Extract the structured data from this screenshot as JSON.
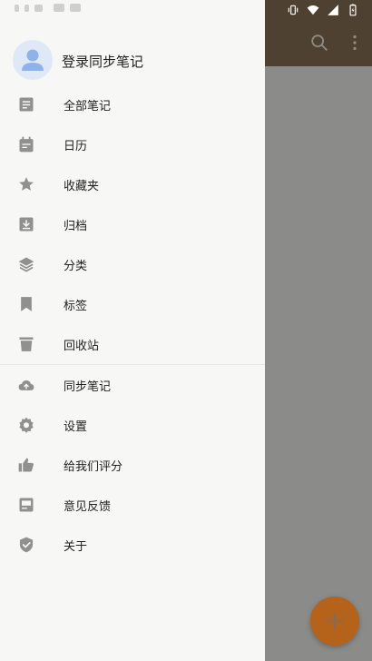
{
  "drawer": {
    "login_title": "登录同步笔记",
    "items": [
      {
        "label": "全部笔记",
        "icon": "notes-icon"
      },
      {
        "label": "日历",
        "icon": "calendar-icon"
      },
      {
        "label": "收藏夹",
        "icon": "star-icon"
      },
      {
        "label": "归档",
        "icon": "archive-icon"
      },
      {
        "label": "分类",
        "icon": "layers-icon"
      },
      {
        "label": "标签",
        "icon": "bookmark-icon"
      },
      {
        "label": "回收站",
        "icon": "trash-icon"
      }
    ],
    "secondary_items": [
      {
        "label": "同步笔记",
        "icon": "cloud-upload-icon"
      },
      {
        "label": "设置",
        "icon": "settings-icon"
      },
      {
        "label": "给我们评分",
        "icon": "thumb-up-icon"
      },
      {
        "label": "意见反馈",
        "icon": "feedback-icon"
      },
      {
        "label": "关于",
        "icon": "shield-icon"
      }
    ]
  },
  "colors": {
    "toolbar": "#4e4131",
    "fab": "#b5631b",
    "drawer_bg": "#f7f7f5",
    "icon_gray": "#909090",
    "scrim_bg": "#8b8b89"
  }
}
